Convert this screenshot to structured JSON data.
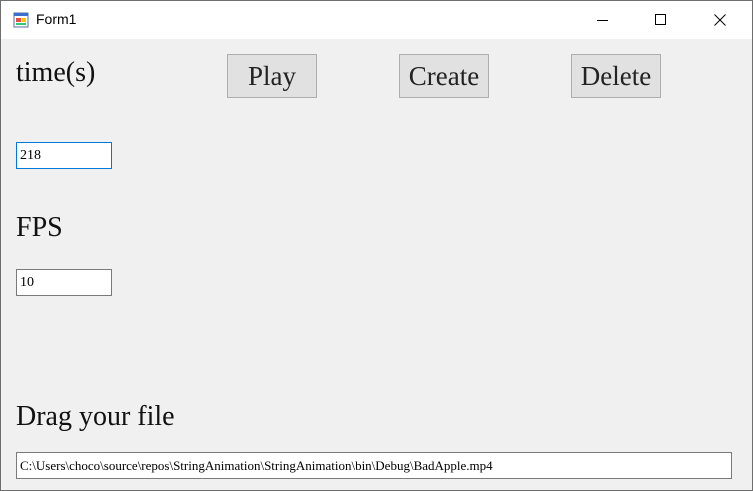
{
  "window": {
    "title": "Form1"
  },
  "labels": {
    "time": "time(s)",
    "fps": "FPS",
    "drag": "Drag your file"
  },
  "buttons": {
    "play": "Play",
    "create": "Create",
    "delete": "Delete"
  },
  "inputs": {
    "time_value": "218",
    "fps_value": "10",
    "file_path": "C:\\Users\\choco\\source\\repos\\StringAnimation\\StringAnimation\\bin\\Debug\\BadApple.mp4"
  },
  "colors": {
    "focus_border": "#0078d7",
    "button_face": "#e1e1e1",
    "form_background": "#f0f0f0"
  }
}
